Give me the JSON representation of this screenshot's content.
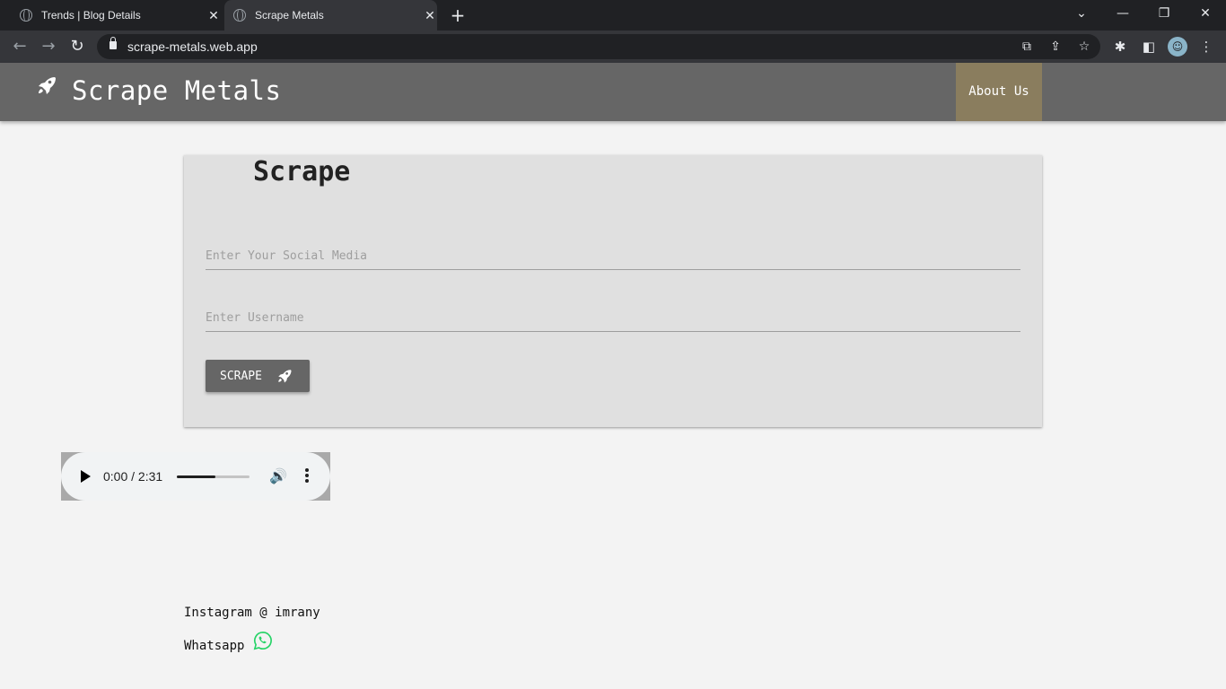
{
  "browser": {
    "tabs": [
      {
        "title": "Trends | Blog Details",
        "active": false
      },
      {
        "title": "Scrape Metals",
        "active": true
      }
    ],
    "url": "scrape-metals.web.app",
    "icons": [
      "back-icon",
      "forward-icon",
      "reload-icon",
      "lock-icon",
      "open-external-icon",
      "share-icon",
      "star-icon",
      "extensions-icon",
      "side-panel-icon",
      "profile-icon",
      "menu-icon"
    ]
  },
  "header": {
    "brand": "Scrape Metals",
    "brand_icon": "rocket-icon",
    "nav_about": "About Us",
    "colors": {
      "header_bg": "#666666",
      "about_bg": "#8a7d5e"
    }
  },
  "form": {
    "title": "Scrape",
    "social_placeholder": "Enter Your Social Media",
    "username_placeholder": "Enter Username",
    "social_value": "",
    "username_value": "",
    "button_label": "SCRAPE",
    "button_icon": "rocket-icon"
  },
  "audio": {
    "time": "0:00 / 2:31",
    "progress": 0.53
  },
  "footer": {
    "instagram": "Instagram @ imrany",
    "whatsapp": "Whatsapp",
    "whatsapp_icon": "whatsapp-icon",
    "whatsapp_color": "#25d366"
  }
}
